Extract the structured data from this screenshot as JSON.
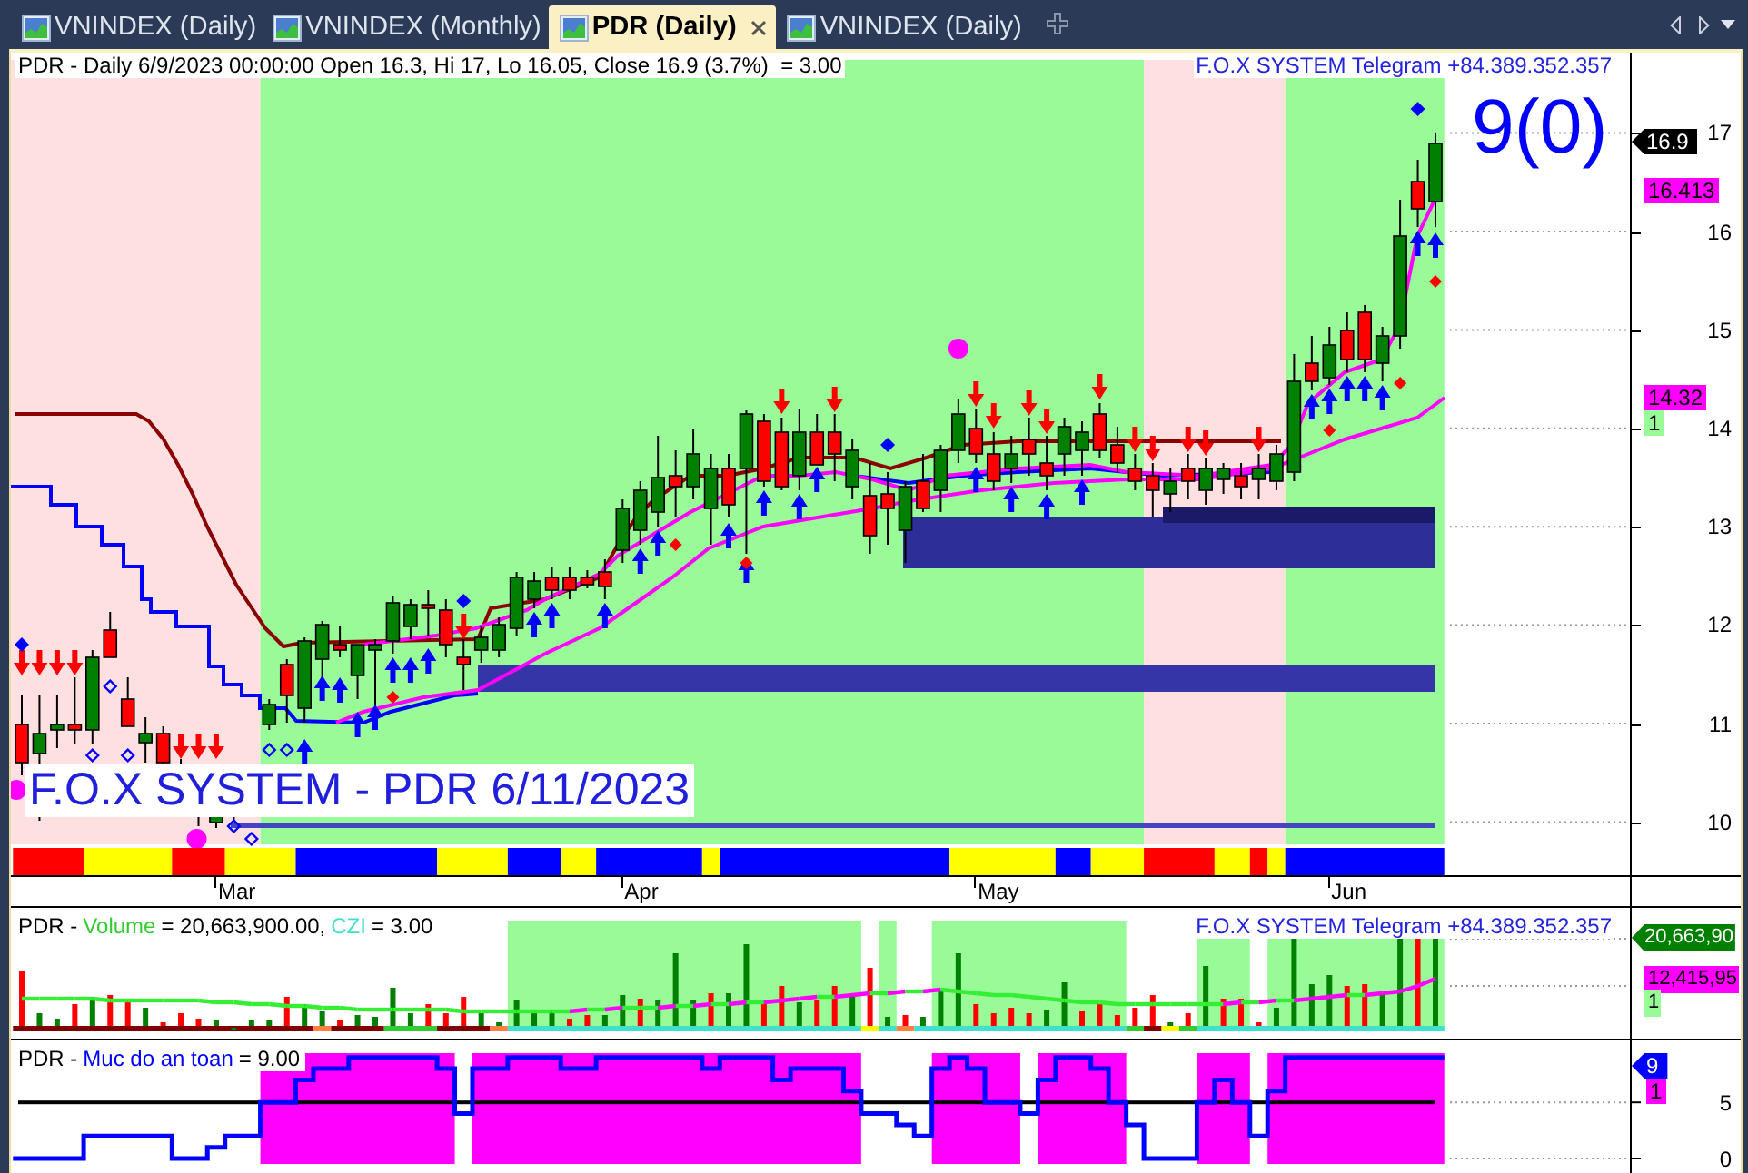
{
  "tabs": [
    {
      "label": "VNINDEX (Daily)",
      "selected": false
    },
    {
      "label": "VNINDEX (Monthly)",
      "selected": false
    },
    {
      "label": "PDR (Daily)",
      "selected": true
    },
    {
      "label": "VNINDEX (Daily)",
      "selected": false
    }
  ],
  "price_panel": {
    "header": "PDR - Daily 6/9/2023 00:00:00 Open 16.3, Hi 17, Lo 16.05, Close 16.9 (3.7%)  = 3.00",
    "contact": "F.O.X SYSTEM Telegram +84.389.352.357",
    "signal_count": "9(0)",
    "caption": "F.O.X SYSTEM - PDR 6/11/2023",
    "axis_ticks": [
      "17",
      "16",
      "15",
      "14",
      "13",
      "12",
      "11",
      "10"
    ],
    "tags": [
      {
        "text": "16.9",
        "kind": "pointer",
        "color": "#000000"
      },
      {
        "text": "16.413",
        "kind": "box",
        "color": "#ff00ff"
      },
      {
        "text": "14.32",
        "kind": "box",
        "color": "#ff00ff"
      },
      {
        "text": "1",
        "kind": "box",
        "color": "#98fb98"
      }
    ]
  },
  "date_axis": [
    "Mar",
    "Apr",
    "May",
    "Jun"
  ],
  "volume_panel": {
    "symbol": "PDR -",
    "legend": [
      {
        "name": "Volume",
        "color": "#33cc33",
        "reading": "= 20,663,900.00,"
      },
      {
        "name": "CZI",
        "color": "#40e0d0",
        "reading": "= 3.00"
      }
    ],
    "contact": "F.O.X SYSTEM Telegram +84.389.352.357",
    "tags": [
      {
        "text": "20,663,90",
        "kind": "pointer",
        "color": "#008000"
      },
      {
        "text": "12,415,95",
        "kind": "box",
        "color": "#ff00ff"
      },
      {
        "text": "1",
        "kind": "box",
        "color": "#98fb98"
      }
    ]
  },
  "safety_panel": {
    "symbol": "PDR -",
    "legend": [
      {
        "name": "Muc do an toan",
        "color": "#0000ff",
        "reading": "= 9.00"
      }
    ],
    "axis_ticks": [
      "5",
      "0"
    ],
    "tags": [
      {
        "text": "9",
        "kind": "pointer",
        "color": "#0000ff"
      },
      {
        "text": "1",
        "kind": "box",
        "color": "#ff00ff"
      }
    ]
  }
}
